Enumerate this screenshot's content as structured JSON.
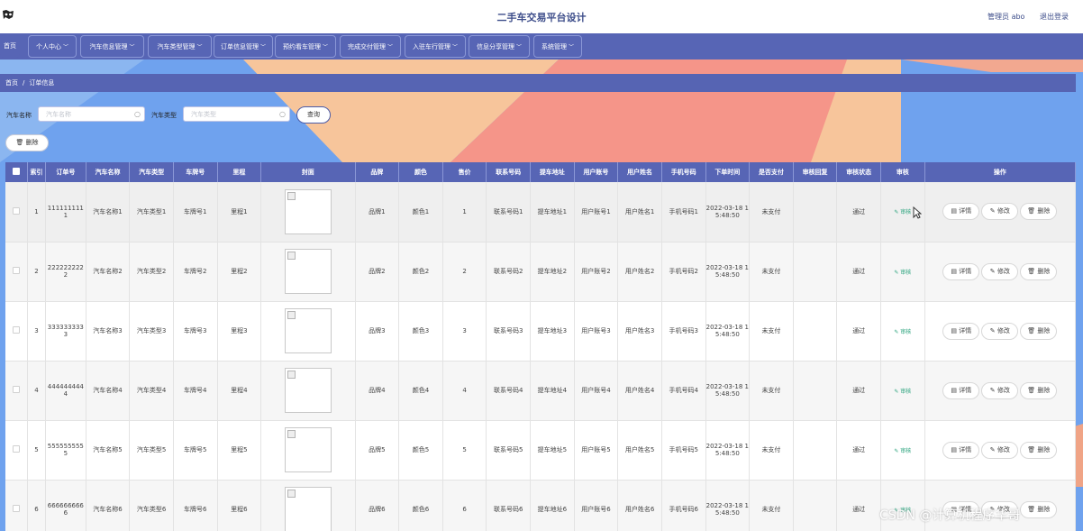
{
  "header": {
    "title": "二手车交易平台设计",
    "user_label": "管理员 abo",
    "logout_label": "退出登录"
  },
  "nav": {
    "home_label": "首页",
    "items": [
      {
        "label": "个人中心"
      },
      {
        "label": "汽车信息管理"
      },
      {
        "label": "汽车类型管理"
      },
      {
        "label": "订单信息管理"
      },
      {
        "label": "预约看车管理"
      },
      {
        "label": "完成交付管理"
      },
      {
        "label": "入驻车行管理"
      },
      {
        "label": "信息分享管理"
      },
      {
        "label": "系统管理"
      }
    ]
  },
  "breadcrumb": {
    "home": "首页",
    "separator": "/",
    "current": "订单信息"
  },
  "search": {
    "car_name_label": "汽车名称",
    "car_name_placeholder": "汽车名称",
    "car_type_label": "汽车类型",
    "car_type_placeholder": "汽车类型",
    "query_label": "查询"
  },
  "toolbar": {
    "delete_label": "删除"
  },
  "table": {
    "columns": [
      "索引",
      "订单号",
      "汽车名称",
      "汽车类型",
      "车牌号",
      "里程",
      "封面",
      "品牌",
      "颜色",
      "售价",
      "联系号码",
      "提车地址",
      "用户账号",
      "用户姓名",
      "手机号码",
      "下单时间",
      "是否支付",
      "审核回复",
      "审核状态",
      "审核",
      "操作"
    ],
    "rows": [
      {
        "index": "1",
        "order": "1111111111",
        "name": "汽车名称1",
        "type": "汽车类型1",
        "plate": "车牌号1",
        "mileage": "里程1",
        "brand": "品牌1",
        "color": "颜色1",
        "price": "1",
        "contact": "联系号码1",
        "address": "提车地址1",
        "account": "用户账号1",
        "username": "用户姓名1",
        "phone": "手机号码1",
        "time": "2022-03-18 15:48:50",
        "paid": "未支付",
        "reply": "",
        "status": "通过"
      },
      {
        "index": "2",
        "order": "2222222222",
        "name": "汽车名称2",
        "type": "汽车类型2",
        "plate": "车牌号2",
        "mileage": "里程2",
        "brand": "品牌2",
        "color": "颜色2",
        "price": "2",
        "contact": "联系号码2",
        "address": "提车地址2",
        "account": "用户账号2",
        "username": "用户姓名2",
        "phone": "手机号码2",
        "time": "2022-03-18 15:48:50",
        "paid": "未支付",
        "reply": "",
        "status": "通过"
      },
      {
        "index": "3",
        "order": "3333333333",
        "name": "汽车名称3",
        "type": "汽车类型3",
        "plate": "车牌号3",
        "mileage": "里程3",
        "brand": "品牌3",
        "color": "颜色3",
        "price": "3",
        "contact": "联系号码3",
        "address": "提车地址3",
        "account": "用户账号3",
        "username": "用户姓名3",
        "phone": "手机号码3",
        "time": "2022-03-18 15:48:50",
        "paid": "未支付",
        "reply": "",
        "status": "通过"
      },
      {
        "index": "4",
        "order": "4444444444",
        "name": "汽车名称4",
        "type": "汽车类型4",
        "plate": "车牌号4",
        "mileage": "里程4",
        "brand": "品牌4",
        "color": "颜色4",
        "price": "4",
        "contact": "联系号码4",
        "address": "提车地址4",
        "account": "用户账号4",
        "username": "用户姓名4",
        "phone": "手机号码4",
        "time": "2022-03-18 15:48:50",
        "paid": "未支付",
        "reply": "",
        "status": "通过"
      },
      {
        "index": "5",
        "order": "5555555555",
        "name": "汽车名称5",
        "type": "汽车类型5",
        "plate": "车牌号5",
        "mileage": "里程5",
        "brand": "品牌5",
        "color": "颜色5",
        "price": "5",
        "contact": "联系号码5",
        "address": "提车地址5",
        "account": "用户账号5",
        "username": "用户姓名5",
        "phone": "手机号码5",
        "time": "2022-03-18 15:48:50",
        "paid": "未支付",
        "reply": "",
        "status": "通过"
      },
      {
        "index": "6",
        "order": "6666666666",
        "name": "汽车名称6",
        "type": "汽车类型6",
        "plate": "车牌号6",
        "mileage": "里程6",
        "brand": "品牌6",
        "color": "颜色6",
        "price": "6",
        "contact": "联系号码6",
        "address": "提车地址6",
        "account": "用户账号6",
        "username": "用户姓名6",
        "phone": "手机号码6",
        "time": "2022-03-18 15:48:50",
        "paid": "未支付",
        "reply": "",
        "status": "通过"
      }
    ],
    "audit_label": "审核",
    "detail_label": "详情",
    "edit_label": "修改",
    "delete_label": "删除"
  },
  "colors": {
    "nav_bg": "#5765b5",
    "title_color": "#3d4d8a",
    "audit_link": "#2aa37d"
  },
  "icons": {
    "logo": "car-logo-icon",
    "search": "search-icon",
    "delete": "trash-icon",
    "detail": "document-icon",
    "edit": "pencil-icon",
    "audit": "pencil-icon",
    "dropdown": "chevron-down-icon"
  },
  "watermark": "CSDN @计算机程序华哥"
}
